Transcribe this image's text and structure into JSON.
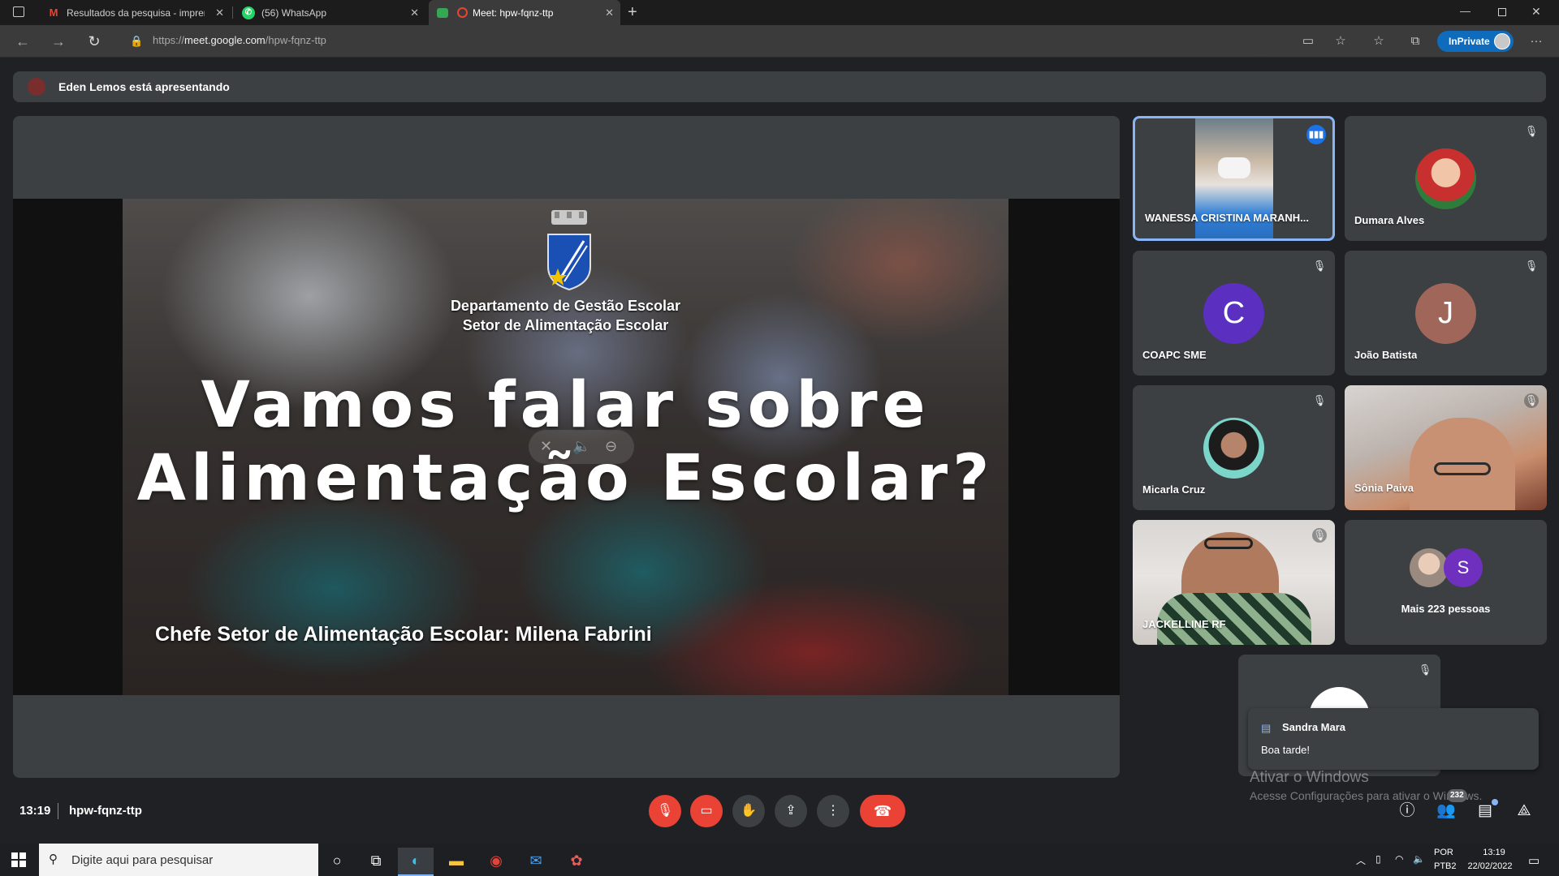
{
  "browser": {
    "tabs": [
      {
        "title": "Resultados da pesquisa - impren",
        "icon": "gmail-icon"
      },
      {
        "title": "(56) WhatsApp",
        "icon": "whatsapp-icon"
      },
      {
        "title": "Meet: hpw-fqnz-ttp",
        "icon": "meet-icon",
        "active": true
      }
    ],
    "url_prefix": "https://",
    "url_host": "meet.google.com",
    "url_path": "/hpw-fqnz-ttp",
    "inprivate_label": "InPrivate",
    "accent": "#0f6cbd"
  },
  "meet": {
    "presenting_text": "Eden Lemos está apresentando",
    "slide": {
      "line1": "Departamento de Gestão Escolar",
      "line2": "Setor de Alimentação Escolar",
      "title1": "Vamos falar sobre",
      "title2": "Alimentação Escolar?",
      "credit": "Chefe Setor de Alimentação Escolar: Milena Fabrini"
    },
    "participants": [
      {
        "name": "WANESSA CRISTINA MARANH...",
        "speaking": true
      },
      {
        "name": "Dumara Alves"
      },
      {
        "name": "COAPC SME",
        "initial": "C",
        "color": "#5b2fbf"
      },
      {
        "name": "João Batista",
        "initial": "J",
        "color": "#a1665a"
      },
      {
        "name": "Micarla Cruz"
      },
      {
        "name": "Sônia Paiva"
      },
      {
        "name": "JACKELLINE RF"
      }
    ],
    "more_people": "Mais 223 pessoas",
    "more_initial": "S",
    "more_color": "#6f2fbf",
    "toast": {
      "sender": "Sandra Mara",
      "message": "Boa tarde!"
    },
    "clock": "13:19",
    "meeting_code": "hpw-fqnz-ttp",
    "people_count": "232",
    "brand_red": "#ea4335"
  },
  "watermark": {
    "line1": "Ativar o Windows",
    "line2": "Acesse Configurações para ativar o Windows."
  },
  "taskbar": {
    "search_placeholder": "Digite aqui para pesquisar",
    "lang1": "POR",
    "lang2": "PTB2",
    "time": "13:19",
    "date": "22/02/2022"
  }
}
